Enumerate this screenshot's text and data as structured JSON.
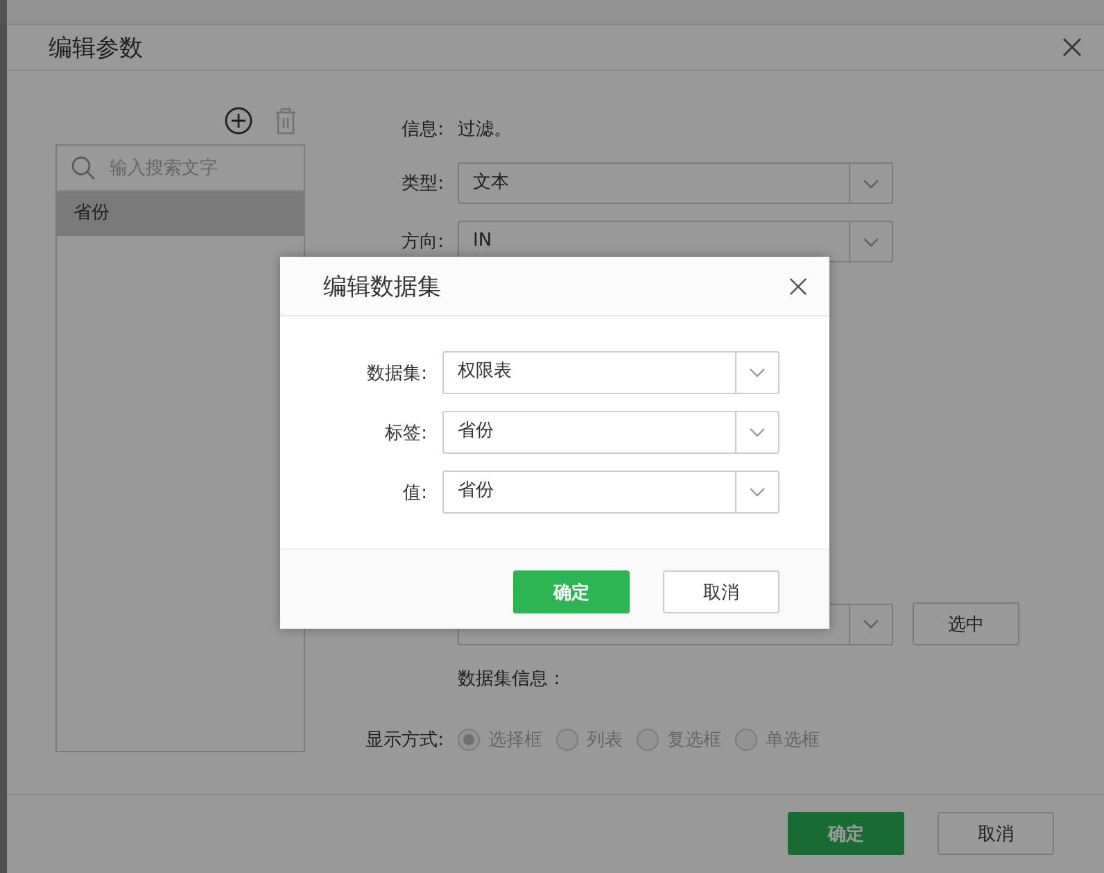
{
  "dialog": {
    "title": "编辑参数"
  },
  "param_panel": {
    "search": {
      "placeholder": "输入搜索文字"
    },
    "items": [
      {
        "label": "省份",
        "selected": true
      }
    ]
  },
  "form": {
    "info": {
      "label": "信息:",
      "value": "过滤。"
    },
    "type": {
      "label": "类型:",
      "value": "文本"
    },
    "direction": {
      "label": "方向:",
      "value": "IN"
    },
    "dataset_select": {
      "button": "选中"
    },
    "dataset_info": "数据集信息：",
    "display_mode": {
      "label": "显示方式:",
      "options": [
        {
          "label": "选择框",
          "selected": true
        },
        {
          "label": "列表",
          "selected": false
        },
        {
          "label": "复选框",
          "selected": false
        },
        {
          "label": "单选框",
          "selected": false
        }
      ]
    }
  },
  "buttons": [
    {
      "label": "确定",
      "kind": "primary"
    },
    {
      "label": "取消",
      "kind": "secondary"
    }
  ],
  "modal": {
    "title": "编辑数据集",
    "fields": [
      {
        "label": "数据集:",
        "value": "权限表"
      },
      {
        "label": "标签:",
        "value": "省份"
      },
      {
        "label": "值:",
        "value": "省份"
      }
    ],
    "buttons": [
      {
        "label": "确定",
        "kind": "primary"
      },
      {
        "label": "取消",
        "kind": "secondary"
      }
    ]
  }
}
